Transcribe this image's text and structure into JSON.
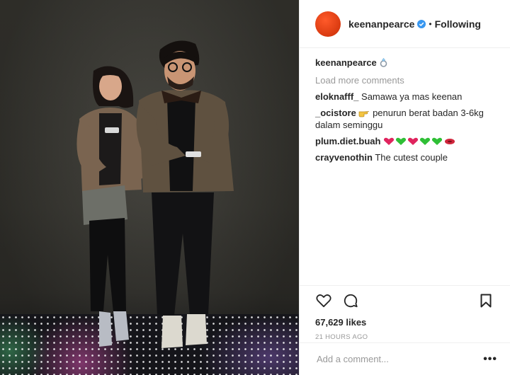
{
  "post": {
    "photo_alt": "",
    "author": "keenanpearce",
    "follow_state": "Following",
    "separator": "•"
  },
  "comments": {
    "caption": {
      "user": "keenanpearce",
      "emoji": "ring-emoji"
    },
    "load_more": "Load more comments",
    "items": [
      {
        "user": "eloknafff_",
        "text": "Samawa ya mas keenan"
      },
      {
        "user": "_ocistore",
        "text": "penurun berat badan 3-6kg dalam seminggu",
        "emoji": "pointing-hand-emoji"
      },
      {
        "user": "plum.diet.buah",
        "text": "",
        "emoji": "hearts-row-emoji"
      },
      {
        "user": "crayvenothin",
        "text": "The cutest couple"
      }
    ]
  },
  "stats": {
    "likes": "67,629 likes",
    "time": "21 HOURS AGO"
  },
  "composer": {
    "placeholder": "Add a comment...",
    "more": "•••"
  },
  "colors": {
    "verified": "#3897f0",
    "avatar": "#e8461a",
    "muted": "#999999"
  }
}
